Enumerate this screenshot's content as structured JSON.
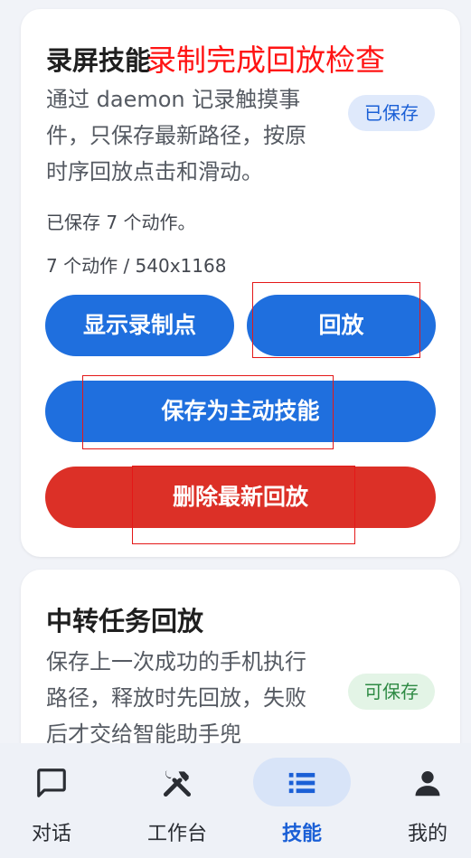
{
  "card_record": {
    "title": "录屏技能",
    "description": "通过 daemon 记录触摸事件，只保存最新路径，按原时序回放点击和滑动。",
    "badge": "已保存",
    "status": "已保存 7 个动作。",
    "meta": "7 个动作 / 540x1168",
    "buttons": {
      "show_points": "显示录制点",
      "replay": "回放",
      "save_as_skill": "保存为主动技能",
      "delete_latest": "删除最新回放"
    }
  },
  "card_relay": {
    "title": "中转任务回放",
    "description": "保存上一次成功的手机执行路径，释放时先回放，失败后才交给智能助手兜",
    "badge": "可保存"
  },
  "annotation": {
    "overlay_text": "录制完成回放检查"
  },
  "bottom_nav": {
    "items": [
      {
        "label": "对话",
        "icon": "chat-icon",
        "active": false
      },
      {
        "label": "工作台",
        "icon": "tools-icon",
        "active": false
      },
      {
        "label": "技能",
        "icon": "list-icon",
        "active": true
      },
      {
        "label": "我的",
        "icon": "person-icon",
        "active": false
      }
    ]
  },
  "colors": {
    "primary_button": "#1f6fde",
    "danger_button": "#dc3027",
    "annotation_red": "#ff1414",
    "active_nav": "#1a5fd6"
  }
}
